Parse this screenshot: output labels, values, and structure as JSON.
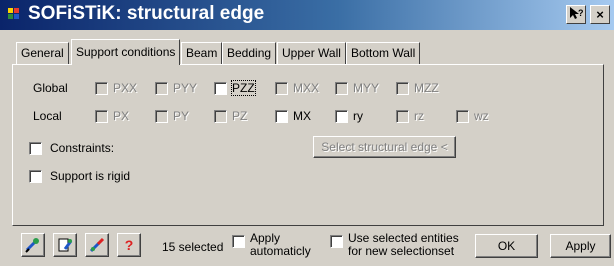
{
  "window": {
    "title": "SOFiSTiK: structural edge",
    "help_icon": "help-cursor-icon",
    "close_glyph": "×"
  },
  "tabs": [
    "General",
    "Support conditions",
    "Beam",
    "Bedding",
    "Upper Wall",
    "Bottom Wall"
  ],
  "active_tab": "Support conditions",
  "rows": {
    "global": {
      "label": "Global",
      "items": [
        "PXX",
        "PYY",
        "PZZ",
        "MXX",
        "MYY",
        "MZZ"
      ]
    },
    "local": {
      "label": "Local",
      "items": [
        "PX",
        "PY",
        "PZ",
        "MX",
        "ry",
        "rz",
        "wz"
      ]
    }
  },
  "constraints": {
    "label": "Constraints:",
    "button": "Select structural edge <"
  },
  "support_rigid": {
    "label": "Support is rigid"
  },
  "footer": {
    "icons": [
      "assign-tool-icon",
      "properties-tool-icon",
      "pick-tool-icon",
      "help-tool-icon"
    ],
    "help_glyph": "?",
    "selected_text": "15 selected",
    "apply_auto": {
      "line1": "Apply",
      "line2": "automaticly"
    },
    "use_selected": {
      "line1": "Use selected entities",
      "line2": "for new selectionset"
    },
    "ok": "OK",
    "apply": "Apply"
  }
}
